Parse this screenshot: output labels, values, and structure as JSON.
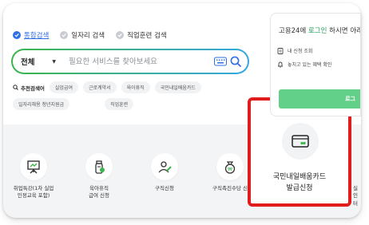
{
  "tabs": [
    {
      "label": "통합검색",
      "active": true
    },
    {
      "label": "일자리 검색",
      "active": false
    },
    {
      "label": "직업훈련 검색",
      "active": false
    }
  ],
  "search": {
    "scope": "전체",
    "placeholder": "필요한 서비스를 찾아보세요"
  },
  "recommended": {
    "title": "추천검색어",
    "chips": [
      "실업급여",
      "근로계약서",
      "육아휴직",
      "국민내일배움카드",
      "일자리채용 청년지원금",
      "직업훈련"
    ]
  },
  "login_panel": {
    "title_prefix": "고용24에 ",
    "title_highlight": "로그인",
    "title_suffix": " 하시면 아래",
    "item1": "내 신청 조회",
    "item2": "놓치고 있는 혜택 확인",
    "button_label": "로그"
  },
  "services": [
    {
      "line1": "취업특강(1차 실업",
      "line2": "인정교육 포함)"
    },
    {
      "line1": "육아휴직",
      "line2": "급여 신청"
    },
    {
      "line1": "구직신청",
      "line2": ""
    },
    {
      "line1": "구직촉진수당 신",
      "line2": ""
    }
  ],
  "highlight_card": {
    "line1": "국민내일배움카드",
    "line2": "발급신청"
  },
  "right_edge": {
    "line1": "실",
    "line2": "인터"
  },
  "colors": {
    "accent_blue": "#2f6fe8",
    "brand_green": "#1f9d55",
    "highlight_red": "#e11c1c"
  }
}
